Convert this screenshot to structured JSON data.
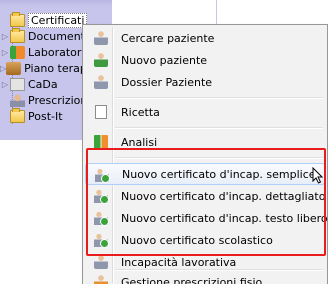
{
  "tree": {
    "items": [
      {
        "label": "Certificati",
        "icon": "folder-icon",
        "selected": true
      },
      {
        "label": "Documenti",
        "icon": "folder-icon"
      },
      {
        "label": "Laboratorio",
        "icon": "lab-icon"
      },
      {
        "label": "Piano terapeutico",
        "icon": "plan-icon"
      },
      {
        "label": "CaDa",
        "icon": "cada-icon"
      },
      {
        "label": "Prescrizioni",
        "icon": "person-icon"
      },
      {
        "label": "Post-It",
        "icon": "folder-icon"
      }
    ]
  },
  "context_menu": {
    "items": [
      {
        "label": "Cercare paziente",
        "icon": "person-search-icon"
      },
      {
        "label": "Nuovo paziente",
        "icon": "person-add-icon"
      },
      {
        "label": "Dossier Paziente",
        "icon": "person-dossier-icon"
      },
      {
        "label": "Ricetta",
        "icon": "prescription-page-icon"
      },
      {
        "label": "Analisi",
        "icon": "analysis-chart-icon"
      },
      {
        "label": "Nuovo certificato d'incap. semplice",
        "icon": "certificate-icon",
        "hovered": true
      },
      {
        "label": "Nuovo certificato d'incap. dettagliato",
        "icon": "certificate-icon"
      },
      {
        "label": "Nuovo certificato d'incap. testo libero",
        "icon": "certificate-icon"
      },
      {
        "label": "Nuovo certificato scolastico",
        "icon": "certificate-icon"
      },
      {
        "label": "Incapacità lavorativa",
        "icon": "work-incapacity-icon"
      },
      {
        "label": "Gestione prescrizioni fisio",
        "icon": "physio-prescription-icon"
      }
    ]
  },
  "colors": {
    "tree_background": "#c7c5ec",
    "menu_background": "#f2f2f2",
    "hover_border": "#aecff7",
    "highlight_box": "#e81c1c"
  }
}
